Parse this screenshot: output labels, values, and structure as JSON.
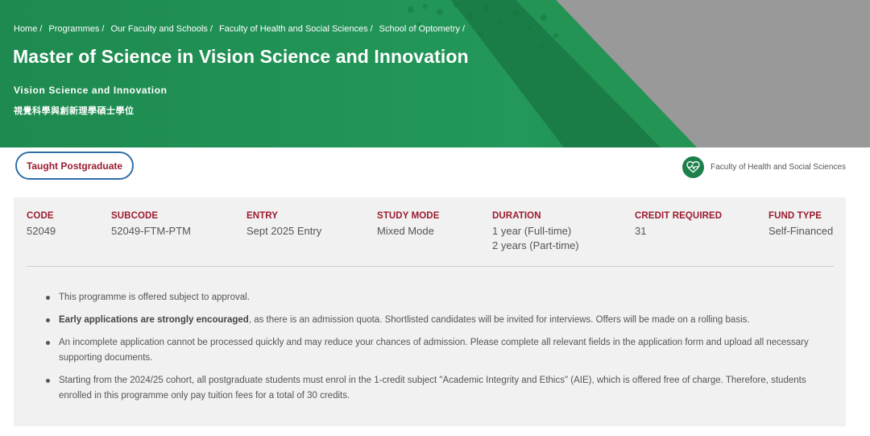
{
  "breadcrumb": [
    {
      "label": "Home"
    },
    {
      "label": "Programmes"
    },
    {
      "label": "Our Faculty and Schools"
    },
    {
      "label": "Faculty of Health and Social Sciences"
    },
    {
      "label": "School of Optometry"
    }
  ],
  "breadcrumb_separator": "/",
  "title": "Master of Science in Vision Science and Innovation",
  "subtitle_en": "Vision Science and Innovation",
  "subtitle_zh": "視覺科學與創新理學碩士學位",
  "tag": "Taught Postgraduate",
  "faculty": {
    "label": "Faculty of Health and Social Sciences",
    "icon": "heart-pulse-icon"
  },
  "info": {
    "code": {
      "label": "CODE",
      "value": "52049"
    },
    "subcode": {
      "label": "SUBCODE",
      "value": "52049-FTM-PTM"
    },
    "entry": {
      "label": "ENTRY",
      "value": "Sept 2025 Entry"
    },
    "study_mode": {
      "label": "STUDY MODE",
      "value": "Mixed Mode"
    },
    "duration": {
      "label": "DURATION",
      "value_line1": "1 year (Full-time)",
      "value_line2": "2 years (Part-time)"
    },
    "credit": {
      "label": "CREDIT REQUIRED",
      "value": "31"
    },
    "fund_type": {
      "label": "FUND TYPE",
      "value": "Self-Financed"
    }
  },
  "notes": [
    {
      "bold": "",
      "text": "This programme is offered subject to approval."
    },
    {
      "bold": "Early applications are strongly encouraged",
      "text": ", as there is an admission quota. Shortlisted candidates will be invited for interviews. Offers will be made on a rolling basis."
    },
    {
      "bold": "",
      "text": "An incomplete application cannot be processed quickly and may reduce your chances of admission. Please complete all relevant fields in the application form and upload all necessary supporting documents."
    },
    {
      "bold": "",
      "text": "Starting from the 2024/25 cohort, all postgraduate students must enrol in the 1-credit subject \"Academic Integrity and Ethics\" (AIE), which is offered free of charge. Therefore, students enrolled in this programme only pay tuition fees for a total of 30 credits."
    }
  ],
  "colors": {
    "hero_green": "#1f8f52",
    "accent_red": "#9b1b2e",
    "pill_border": "#2f6fa8",
    "panel_bg": "#f1f1f1"
  }
}
